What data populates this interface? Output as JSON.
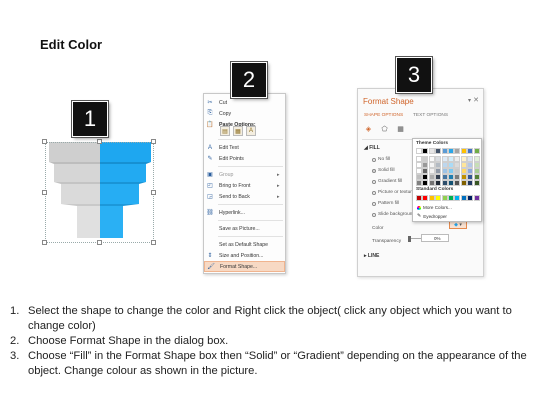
{
  "page_title": "Edit Color",
  "badges": [
    "1",
    "2",
    "3"
  ],
  "context_menu": {
    "items": [
      {
        "label": "Cut",
        "icon": "scissors-icon",
        "glyph": "✂"
      },
      {
        "label": "Copy",
        "icon": "copy-icon",
        "glyph": "⎘"
      },
      {
        "label": "Paste Options:",
        "icon": "clipboard-icon",
        "glyph": "📋"
      },
      {
        "label": "Edit Text",
        "icon": "edit-text-icon",
        "glyph": "A"
      },
      {
        "label": "Edit Points",
        "icon": "edit-points-icon",
        "glyph": "✎"
      },
      {
        "label": "Group",
        "icon": "group-icon",
        "glyph": "▣",
        "submenu": true
      },
      {
        "label": "Bring to Front",
        "icon": "bring-front-icon",
        "glyph": "◰",
        "submenu": true
      },
      {
        "label": "Send to Back",
        "icon": "send-back-icon",
        "glyph": "◲",
        "submenu": true
      },
      {
        "label": "Hyperlink...",
        "icon": "hyperlink-icon",
        "glyph": "⛓"
      },
      {
        "label": "Save as Picture...",
        "icon": "",
        "glyph": ""
      },
      {
        "label": "Set as Default Shape",
        "icon": "",
        "glyph": ""
      },
      {
        "label": "Size and Position...",
        "icon": "size-position-icon",
        "glyph": "⇕"
      },
      {
        "label": "Format Shape...",
        "icon": "format-shape-icon",
        "glyph": "🖌"
      }
    ]
  },
  "format_pane": {
    "title": "Format Shape",
    "tabs": [
      "SHAPE OPTIONS",
      "TEXT OPTIONS"
    ],
    "fill_section": "FILL",
    "fill_options": [
      "No fill",
      "Solid fill",
      "Gradient fill",
      "Picture or texture fill",
      "Pattern fill",
      "Slide background fill"
    ],
    "color_label": "Color",
    "transparency_label": "Transparency",
    "transparency_value": "0%",
    "line_section": "LINE",
    "palette": {
      "theme_header": "Theme Colors",
      "standard_header": "Standard Colors",
      "more_colors": "More Colors...",
      "eyedropper": "Eyedropper",
      "theme_base": [
        "#ffffff",
        "#000000",
        "#e7e6e6",
        "#44546a",
        "#5b9bd5",
        "#2aa6e8",
        "#a5a5a5",
        "#ffc000",
        "#4472c4",
        "#70ad47"
      ],
      "standard": [
        "#c00000",
        "#ff0000",
        "#ffc000",
        "#ffff00",
        "#92d050",
        "#00b050",
        "#00b0f0",
        "#0070c0",
        "#002060",
        "#7030a0"
      ]
    }
  },
  "instructions": [
    {
      "num": "1.",
      "text": "Select the shape to change the color and Right click the object( click any object which you want to change color)"
    },
    {
      "num": "2.",
      "text": "Choose Format Shape in the dialog box."
    },
    {
      "num": "3.",
      "text": "Choose “Fill” in the Format Shape box then “Solid” or “Gradient” depending on the appearance of the object. Change colour as shown in the picture."
    }
  ],
  "colors": {
    "accent": "#d0652b",
    "funnel_blue": "#1ea7f0",
    "funnel_gray": "#cfcfcf"
  }
}
